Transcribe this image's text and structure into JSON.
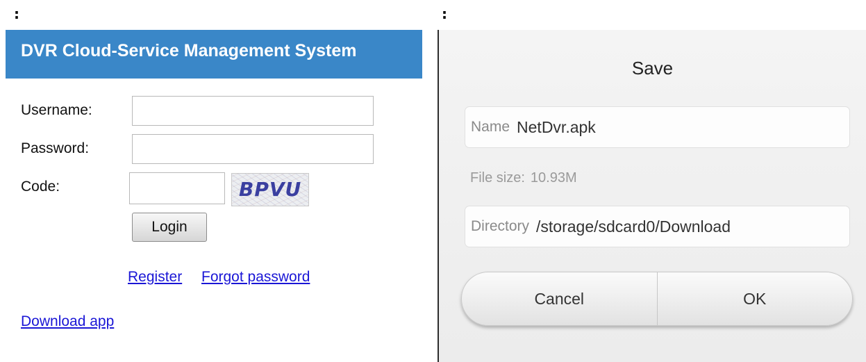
{
  "markers": {
    "left": ":",
    "right": ":"
  },
  "login": {
    "title": "DVR Cloud-Service Management System",
    "username_label": "Username:",
    "username_value": "",
    "password_label": "Password:",
    "password_value": "",
    "code_label": "Code:",
    "code_value": "",
    "captcha_text": "BPVU",
    "login_button": "Login",
    "register_link": "Register",
    "forgot_link": "Forgot password",
    "download_link": "Download app",
    "colors": {
      "banner": "#3a87c8",
      "link": "#1a16d6"
    }
  },
  "save_dialog": {
    "title": "Save",
    "name_label": "Name",
    "name_value": "NetDvr.apk",
    "filesize_label": "File size:",
    "filesize_value": "10.93M",
    "directory_label": "Directory",
    "directory_value": "/storage/sdcard0/Download",
    "cancel_button": "Cancel",
    "ok_button": "OK"
  }
}
